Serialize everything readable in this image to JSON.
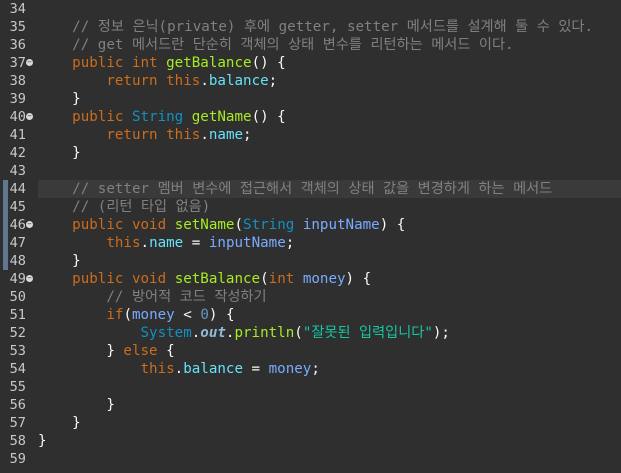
{
  "editor": {
    "lines": [
      {
        "num": "34",
        "fold": false,
        "tokens": []
      },
      {
        "num": "35",
        "fold": false,
        "tokens": [
          {
            "cls": "p",
            "text": "    "
          },
          {
            "cls": "c",
            "text": "// 정보 은닉(private) 후에 getter, setter 메서드를 설계해 둘 수 있다."
          }
        ]
      },
      {
        "num": "36",
        "fold": false,
        "tokens": [
          {
            "cls": "p",
            "text": "    "
          },
          {
            "cls": "c",
            "text": "// get 메서드란 단순히 객체의 상태 변수를 리턴하는 메서드 이다."
          }
        ]
      },
      {
        "num": "37",
        "fold": true,
        "tokens": [
          {
            "cls": "p",
            "text": "    "
          },
          {
            "cls": "k",
            "text": "public"
          },
          {
            "cls": "p",
            "text": " "
          },
          {
            "cls": "k",
            "text": "int"
          },
          {
            "cls": "p",
            "text": " "
          },
          {
            "cls": "f",
            "text": "getBalance"
          },
          {
            "cls": "p",
            "text": "() {"
          }
        ]
      },
      {
        "num": "38",
        "fold": false,
        "tokens": [
          {
            "cls": "p",
            "text": "        "
          },
          {
            "cls": "k",
            "text": "return"
          },
          {
            "cls": "p",
            "text": " "
          },
          {
            "cls": "k",
            "text": "this"
          },
          {
            "cls": "p",
            "text": "."
          },
          {
            "cls": "fd",
            "text": "balance"
          },
          {
            "cls": "p",
            "text": ";"
          }
        ]
      },
      {
        "num": "39",
        "fold": false,
        "tokens": [
          {
            "cls": "p",
            "text": "    }"
          }
        ]
      },
      {
        "num": "40",
        "fold": true,
        "tokens": [
          {
            "cls": "p",
            "text": "    "
          },
          {
            "cls": "k",
            "text": "public"
          },
          {
            "cls": "p",
            "text": " "
          },
          {
            "cls": "t",
            "text": "String"
          },
          {
            "cls": "p",
            "text": " "
          },
          {
            "cls": "f",
            "text": "getName"
          },
          {
            "cls": "p",
            "text": "() {"
          }
        ]
      },
      {
        "num": "41",
        "fold": false,
        "tokens": [
          {
            "cls": "p",
            "text": "        "
          },
          {
            "cls": "k",
            "text": "return"
          },
          {
            "cls": "p",
            "text": " "
          },
          {
            "cls": "k",
            "text": "this"
          },
          {
            "cls": "p",
            "text": "."
          },
          {
            "cls": "fd",
            "text": "name"
          },
          {
            "cls": "p",
            "text": ";"
          }
        ]
      },
      {
        "num": "42",
        "fold": false,
        "tokens": [
          {
            "cls": "p",
            "text": "    }"
          }
        ]
      },
      {
        "num": "43",
        "fold": false,
        "tokens": []
      },
      {
        "num": "44",
        "fold": false,
        "current": true,
        "tokens": [
          {
            "cls": "p",
            "text": "    "
          },
          {
            "cls": "c",
            "text": "// setter 멤버 변수에 접근해서 객체의 상태 값을 변경하게 하는 메서드"
          }
        ]
      },
      {
        "num": "45",
        "fold": false,
        "tokens": [
          {
            "cls": "p",
            "text": "    "
          },
          {
            "cls": "c",
            "text": "// (리턴 타입 없음)"
          }
        ]
      },
      {
        "num": "46",
        "fold": true,
        "tokens": [
          {
            "cls": "p",
            "text": "    "
          },
          {
            "cls": "k",
            "text": "public"
          },
          {
            "cls": "p",
            "text": " "
          },
          {
            "cls": "k",
            "text": "void"
          },
          {
            "cls": "p",
            "text": " "
          },
          {
            "cls": "f",
            "text": "setName"
          },
          {
            "cls": "p",
            "text": "("
          },
          {
            "cls": "t",
            "text": "String"
          },
          {
            "cls": "p",
            "text": " "
          },
          {
            "cls": "v",
            "text": "inputName"
          },
          {
            "cls": "p",
            "text": ") {"
          }
        ]
      },
      {
        "num": "47",
        "fold": false,
        "tokens": [
          {
            "cls": "p",
            "text": "        "
          },
          {
            "cls": "k",
            "text": "this"
          },
          {
            "cls": "p",
            "text": "."
          },
          {
            "cls": "fd",
            "text": "name"
          },
          {
            "cls": "p",
            "text": " = "
          },
          {
            "cls": "v",
            "text": "inputName"
          },
          {
            "cls": "p",
            "text": ";"
          }
        ]
      },
      {
        "num": "48",
        "fold": false,
        "tokens": [
          {
            "cls": "p",
            "text": "    }"
          }
        ]
      },
      {
        "num": "49",
        "fold": true,
        "tokens": [
          {
            "cls": "p",
            "text": "    "
          },
          {
            "cls": "k",
            "text": "public"
          },
          {
            "cls": "p",
            "text": " "
          },
          {
            "cls": "k",
            "text": "void"
          },
          {
            "cls": "p",
            "text": " "
          },
          {
            "cls": "f",
            "text": "setBalance"
          },
          {
            "cls": "p",
            "text": "("
          },
          {
            "cls": "k",
            "text": "int"
          },
          {
            "cls": "p",
            "text": " "
          },
          {
            "cls": "v",
            "text": "money"
          },
          {
            "cls": "p",
            "text": ") {"
          }
        ]
      },
      {
        "num": "50",
        "fold": false,
        "tokens": [
          {
            "cls": "p",
            "text": "        "
          },
          {
            "cls": "c",
            "text": "// 방어적 코드 작성하기"
          }
        ]
      },
      {
        "num": "51",
        "fold": false,
        "tokens": [
          {
            "cls": "p",
            "text": "        "
          },
          {
            "cls": "k",
            "text": "if"
          },
          {
            "cls": "p",
            "text": "("
          },
          {
            "cls": "v",
            "text": "money"
          },
          {
            "cls": "p",
            "text": " < "
          },
          {
            "cls": "n",
            "text": "0"
          },
          {
            "cls": "p",
            "text": ") {"
          }
        ]
      },
      {
        "num": "52",
        "fold": false,
        "tokens": [
          {
            "cls": "p",
            "text": "            "
          },
          {
            "cls": "sys",
            "text": "System"
          },
          {
            "cls": "p",
            "text": "."
          },
          {
            "cls": "out",
            "text": "out"
          },
          {
            "cls": "p",
            "text": "."
          },
          {
            "cls": "m",
            "text": "println"
          },
          {
            "cls": "p",
            "text": "("
          },
          {
            "cls": "s",
            "text": "\"잘못된 입력입니다\""
          },
          {
            "cls": "p",
            "text": ");"
          }
        ]
      },
      {
        "num": "53",
        "fold": false,
        "tokens": [
          {
            "cls": "p",
            "text": "        } "
          },
          {
            "cls": "k",
            "text": "else"
          },
          {
            "cls": "p",
            "text": " {"
          }
        ]
      },
      {
        "num": "54",
        "fold": false,
        "tokens": [
          {
            "cls": "p",
            "text": "            "
          },
          {
            "cls": "k",
            "text": "this"
          },
          {
            "cls": "p",
            "text": "."
          },
          {
            "cls": "fd",
            "text": "balance"
          },
          {
            "cls": "p",
            "text": " = "
          },
          {
            "cls": "v",
            "text": "money"
          },
          {
            "cls": "p",
            "text": ";"
          }
        ]
      },
      {
        "num": "55",
        "fold": false,
        "tokens": []
      },
      {
        "num": "56",
        "fold": false,
        "tokens": [
          {
            "cls": "p",
            "text": "        }"
          }
        ]
      },
      {
        "num": "57",
        "fold": false,
        "tokens": [
          {
            "cls": "p",
            "text": "    }"
          }
        ]
      },
      {
        "num": "58",
        "fold": false,
        "tokens": [
          {
            "cls": "p",
            "text": "}"
          }
        ]
      },
      {
        "num": "59",
        "fold": false,
        "tokens": []
      }
    ]
  },
  "colors": {
    "background": "#2f2f2f",
    "current_line": "#3a3a3a",
    "change_marker": "#5f7890",
    "comment": "#808080",
    "keyword": "#cc6c1d",
    "method": "#a7ec21",
    "type": "#1290c3",
    "field": "#66e1f8",
    "variable": "#79abff",
    "string": "#17c6a3",
    "number": "#6897bb"
  }
}
